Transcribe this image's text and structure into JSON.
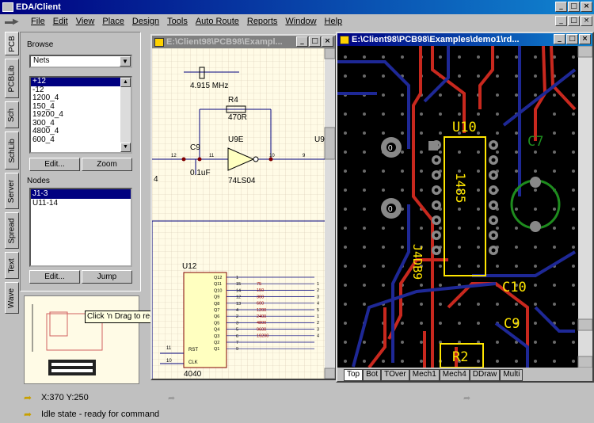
{
  "app": {
    "title": "EDA/Client"
  },
  "menu": [
    "File",
    "Edit",
    "View",
    "Place",
    "Design",
    "Tools",
    "Auto Route",
    "Reports",
    "Window",
    "Help"
  ],
  "vtabs": [
    "PCB",
    "PCBLib",
    "Sch",
    "SchLib",
    "Server",
    "Spread",
    "Text",
    "Wave"
  ],
  "panel": {
    "browse_label": "Browse",
    "browse_value": "Nets",
    "nets": [
      "+12",
      "-12",
      "1200_4",
      "150_4",
      "19200_4",
      "300_4",
      "4800_4",
      "600_4"
    ],
    "edit_label": "Edit...",
    "zoom_label": "Zoom",
    "nodes_label": "Nodes",
    "nodes": [
      "J1-3",
      "U11-14"
    ],
    "edit2_label": "Edit...",
    "jump_label": "Jump"
  },
  "tooltip": "Click 'n Drag to re-position",
  "sch_window": {
    "title": "E:\\Client98\\PCB98\\Exampl...",
    "crystal_label": "4.915 MHz",
    "r4_ref": "R4",
    "r4_val": "470R",
    "c9_ref": "C9",
    "c9_val": "0.1uF",
    "u9e_ref": "U9E",
    "u9e_type": "74LS04",
    "u9_partial": "U9",
    "pin_12": "12",
    "pin_11": "11",
    "pin_10": "10",
    "pin_9": "9",
    "left_4": "4",
    "u12_ref": "U12",
    "u12_type": "4040",
    "u12_pins_out": [
      "Q12",
      "Q11",
      "Q10",
      "Q9",
      "Q8",
      "Q7",
      "Q6",
      "Q5",
      "Q4",
      "Q3",
      "Q2",
      "Q1"
    ],
    "u12_pins_num": [
      "1",
      "15",
      "14",
      "12",
      "13",
      "4",
      "2",
      "3",
      "5",
      "6",
      "7",
      "9"
    ],
    "u12_pins_in": [
      "RST",
      "CLK"
    ],
    "in_11": "11",
    "in_10": "10",
    "baud_labels": [
      "75",
      "150",
      "300",
      "600",
      "1200",
      "2400",
      "4800",
      "9600",
      "19200"
    ],
    "bus_nums": [
      "1",
      "2",
      "3",
      "4",
      "5",
      "1",
      "2",
      "3",
      "4"
    ]
  },
  "pcb_window": {
    "title": "E:\\Client98\\PCB98\\Examples\\demo1\\rd...",
    "labels": {
      "u10": "U10",
      "c7": "C7",
      "c10": "C10",
      "c9": "C9",
      "r2": "R2",
      "j4": "J4DB9",
      "a485": "1485",
      "pad0a": "0",
      "pad0b": "0"
    },
    "layer_tabs": [
      "Top",
      "Bot",
      "TOver",
      "Mech1",
      "Mech4",
      "DDraw",
      "Multi"
    ]
  },
  "status": {
    "coords": "X:370 Y:250",
    "state": "Idle state - ready for command"
  },
  "colors": {
    "title_start": "#000080",
    "title_end": "#1084d0",
    "pcb_bg": "#000000",
    "track_red": "#c8281e",
    "track_blue": "#1e2896",
    "overlay_yellow": "#ffe600",
    "green": "#1e8c1e"
  }
}
